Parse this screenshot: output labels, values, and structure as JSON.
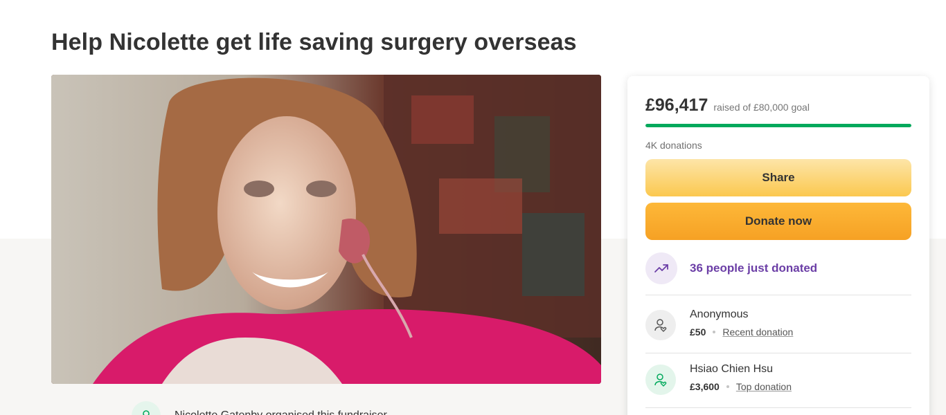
{
  "page": {
    "title": "Help Nicolette get life saving surgery overseas"
  },
  "organizer": {
    "text": "Nicolette Gatenby organised this fundraiser"
  },
  "stats": {
    "raised_amount": "£96,417",
    "raised_of": "raised of £80,000 goal",
    "progress_fraction": 1.0,
    "donation_count": "4K donations"
  },
  "buttons": {
    "share_label": "Share",
    "donate_label": "Donate now"
  },
  "trend": {
    "icon": "trending-up-icon",
    "text": "36 people just donated"
  },
  "donations": [
    {
      "name": "Anonymous",
      "amount": "£50",
      "tag": "Recent donation",
      "icon": "user-heart-icon"
    },
    {
      "name": "Hsiao Chien Hsu",
      "amount": "£3,600",
      "tag": "Top donation",
      "icon": "user-heart-icon"
    }
  ],
  "colors": {
    "progress": "#02a95c",
    "share_button": "#fbc84f",
    "donate_button": "#f6a124",
    "trend_text": "#6b3ea6"
  }
}
